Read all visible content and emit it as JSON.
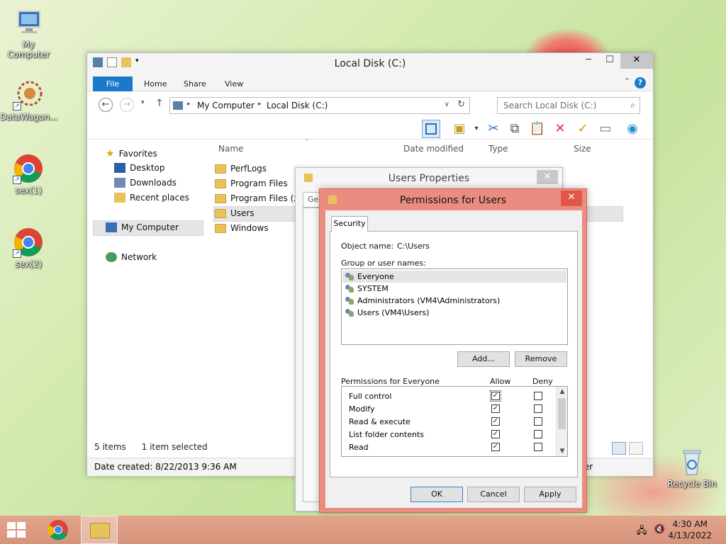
{
  "desktop": {
    "icons": [
      {
        "label": "My Computer"
      },
      {
        "label": "DataWagon..."
      },
      {
        "label": "sex(1)"
      },
      {
        "label": "sex(2)"
      },
      {
        "label": "Recycle Bin"
      }
    ]
  },
  "explorer": {
    "title": "Local Disk (C:)",
    "tabs": {
      "file": "File",
      "home": "Home",
      "share": "Share",
      "view": "View"
    },
    "breadcrumb": [
      "My Computer",
      "Local Disk (C:)"
    ],
    "search_placeholder": "Search Local Disk (C:)",
    "nav": {
      "favorites": "Favorites",
      "desktop": "Desktop",
      "downloads": "Downloads",
      "recent": "Recent places",
      "my_computer": "My Computer",
      "network": "Network"
    },
    "columns": {
      "name": "Name",
      "date": "Date modified",
      "type": "Type",
      "size": "Size"
    },
    "files": [
      "PerfLogs",
      "Program Files",
      "Program Files (x8",
      "Users",
      "Windows"
    ],
    "status_items": "5 items",
    "status_selected": "1 item selected",
    "details": "Date created: 8/22/2013 9:36 AM",
    "details_right": "ter"
  },
  "users_properties": {
    "title": "Users Properties",
    "tab_partial": "Ge"
  },
  "permissions": {
    "title": "Permissions for Users",
    "tab": "Security",
    "object_label": "Object name:",
    "object_value": "C:\\Users",
    "group_label": "Group or user names:",
    "users": [
      "Everyone",
      "SYSTEM",
      "Administrators (VM4\\Administrators)",
      "Users (VM4\\Users)"
    ],
    "add_btn": "Add...",
    "remove_btn": "Remove",
    "perm_header": "Permissions for Everyone",
    "allow_header": "Allow",
    "deny_header": "Deny",
    "perms": [
      {
        "name": "Full control"
      },
      {
        "name": "Modify"
      },
      {
        "name": "Read & execute"
      },
      {
        "name": "List folder contents"
      },
      {
        "name": "Read"
      }
    ],
    "ok_btn": "OK",
    "cancel_btn": "Cancel",
    "apply_btn": "Apply"
  },
  "taskbar": {
    "time": "4:30 AM",
    "date": "4/13/2022"
  }
}
